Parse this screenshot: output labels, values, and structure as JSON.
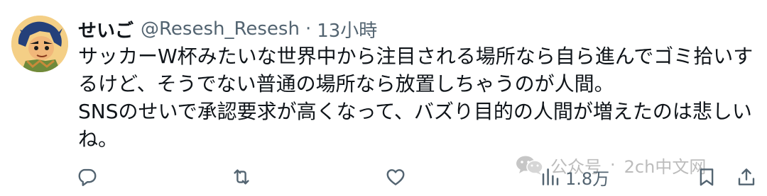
{
  "user": {
    "display_name": "せいご",
    "handle": "@Resesh_Resesh",
    "separator": "·",
    "time": "13小時"
  },
  "tweet": {
    "lines": [
      "サッカーW杯みたいな世界中から注目される場所なら自ら進んでゴミ拾いす",
      "るけど、そうでない普通の場所なら放置しちゃうのが人間。",
      "SNSのせいで承認要求が高くなって、バズり目的の人間が増えたのは悲しい",
      "ね。"
    ]
  },
  "actions": {
    "reply_icon": "reply-icon",
    "retweet_icon": "retweet-icon",
    "like_icon": "heart-icon",
    "views_icon": "views-bar-chart-icon",
    "views_count": "1.8万",
    "bookmark_icon": "bookmark-icon",
    "share_icon": "share-icon"
  },
  "watermark": {
    "icon": "wechat-icon",
    "account_label": "公众号",
    "separator": "·",
    "name": "2ch中文网"
  },
  "colors": {
    "text_primary": "#0f1419",
    "text_secondary": "#536471",
    "watermark": "#b9b9b9"
  }
}
